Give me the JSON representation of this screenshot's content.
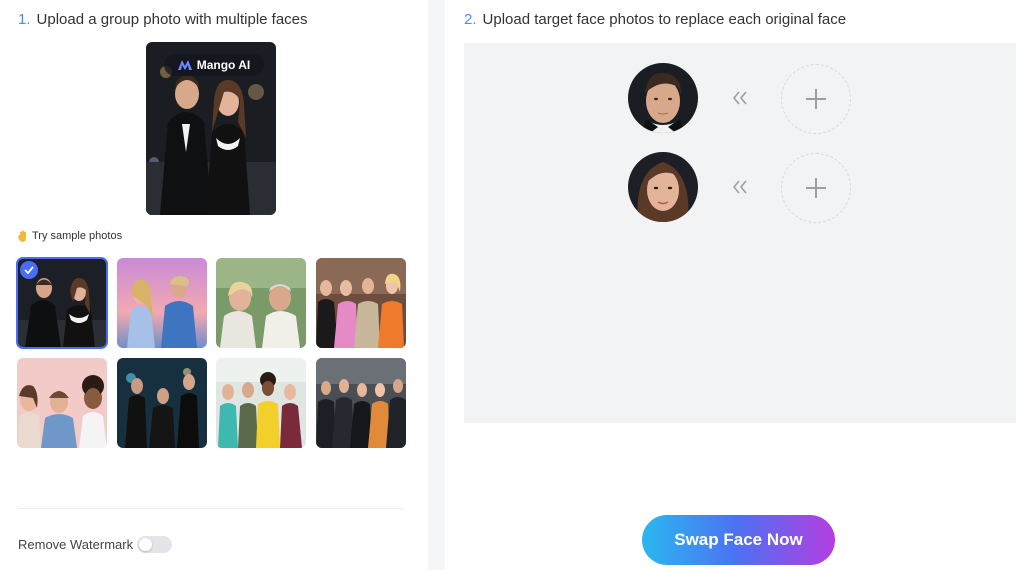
{
  "step1": {
    "number": "1.",
    "title": "Upload a group photo with multiple faces"
  },
  "brand": {
    "name": "Mango AI"
  },
  "samples": {
    "label": "Try sample photos",
    "photos": [
      "couple-tuxedo",
      "couple-beach",
      "elderly-couple",
      "women-group",
      "friends-four",
      "men-night",
      "women-group-outdoor",
      "office-group"
    ],
    "selected_index": 0
  },
  "step2": {
    "number": "2.",
    "title": "Upload target face photos to replace each original face"
  },
  "faces": [
    {
      "original": "man-face",
      "target": "add-icon"
    },
    {
      "original": "woman-face",
      "target": "add-icon"
    }
  ],
  "watermark": {
    "label": "Remove Watermark",
    "enabled": false
  },
  "swap_button": {
    "label": "Swap Face Now"
  },
  "colors": {
    "accent": "#4a6cf7",
    "step_number": "#4a8cf0",
    "button_gradient": [
      "#2ab8f0",
      "#4d70f2",
      "#b53ee0"
    ]
  }
}
